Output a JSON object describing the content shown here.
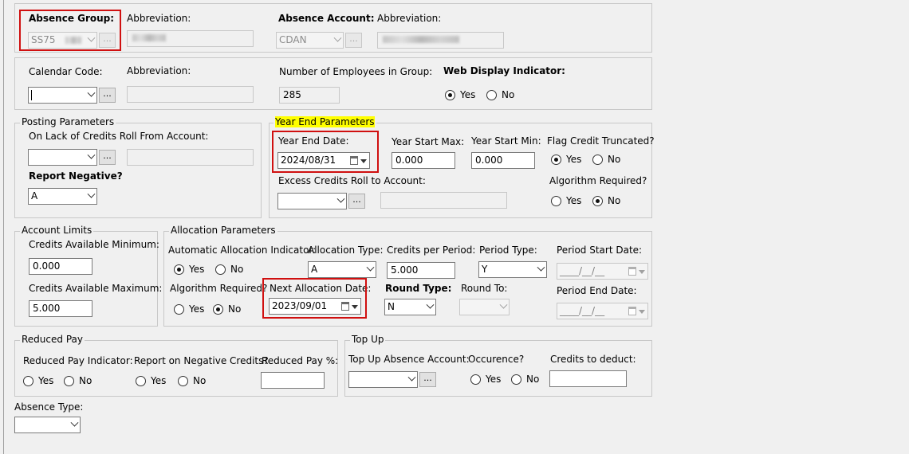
{
  "top": {
    "absence_group_label": "Absence Group:",
    "absence_group_value": "SS75",
    "abbreviation_label": "Abbreviation:",
    "absence_account_label": "Absence Account:",
    "absence_account_value": "CDAN",
    "abbreviation2_label": "Abbreviation:"
  },
  "row2": {
    "calendar_code_label": "Calendar Code:",
    "abbreviation_label": "Abbreviation:",
    "num_employees_label": "Number of Employees in Group:",
    "num_employees_value": "285",
    "web_display_label": "Web Display Indicator:",
    "yes_label": "Yes",
    "no_label": "No"
  },
  "posting": {
    "legend": "Posting Parameters",
    "lack_credits_label": "On Lack of Credits Roll From Account:",
    "report_negative_label": "Report Negative?",
    "report_negative_value": "A"
  },
  "year_end": {
    "legend": "Year End Parameters",
    "year_end_date_label": "Year End Date:",
    "year_end_date_value": "2024/08/31",
    "start_max_label": "Year Start Max:",
    "start_max_value": "0.000",
    "start_min_label": "Year Start Min:",
    "start_min_value": "0.000",
    "flag_credit_label": "Flag Credit Truncated?",
    "excess_credits_label": "Excess Credits Roll to Account:",
    "algorithm_label": "Algorithm Required?",
    "yes_label": "Yes",
    "no_label": "No"
  },
  "limits": {
    "legend": "Account Limits",
    "min_label": "Credits Available Minimum:",
    "min_value": "0.000",
    "max_label": "Credits Available Maximum:",
    "max_value": "5.000"
  },
  "allocation": {
    "legend": "Allocation Parameters",
    "auto_label": "Automatic Allocation Indicator:",
    "type_label": "Allocation Type:",
    "type_value": "A",
    "credits_per_period_label": "Credits per Period:",
    "credits_per_period_value": "5.000",
    "period_type_label": "Period Type:",
    "period_type_value": "Y",
    "period_start_label": "Period Start Date:",
    "period_start_value": "____/__/__",
    "algorithm_label": "Algorithm Required?",
    "next_alloc_label": "Next Allocation Date:",
    "next_alloc_value": "2023/09/01",
    "round_type_label": "Round Type:",
    "round_type_value": "N",
    "round_to_label": "Round To:",
    "period_end_label": "Period End Date:",
    "period_end_value": "____/__/__",
    "yes_label": "Yes",
    "no_label": "No"
  },
  "reduced": {
    "legend": "Reduced Pay",
    "indicator_label": "Reduced Pay Indicator:",
    "report_neg_label": "Report on Negative Credits?",
    "percent_label": "Reduced Pay %:",
    "yes_label": "Yes",
    "no_label": "No"
  },
  "topup": {
    "legend": "Top Up",
    "account_label": "Top Up Absence Account:",
    "occurence_label": "Occurence?",
    "credits_deduct_label": "Credits to deduct:",
    "yes_label": "Yes",
    "no_label": "No"
  },
  "absence_type": {
    "label": "Absence Type:"
  },
  "colors": {
    "highlight": "#ffff00",
    "annotation_red": "#d01010"
  }
}
